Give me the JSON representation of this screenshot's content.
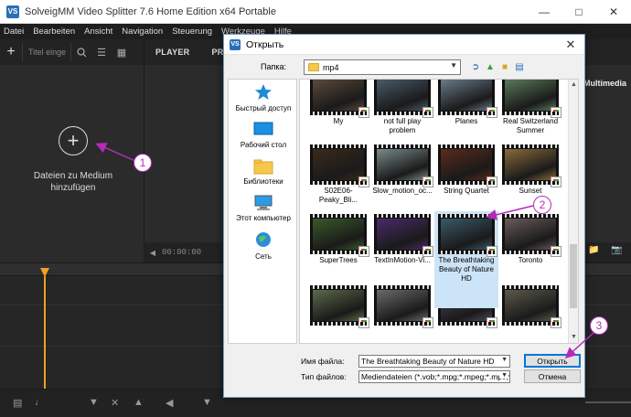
{
  "app": {
    "title": "SolveigMM Video Splitter 7.6 Home Edition x64 Portable",
    "logo": "VS",
    "menu": [
      "Datei",
      "Bearbeiten",
      "Ansicht",
      "Navigation",
      "Steuerung",
      "Werkzeuge",
      "Hilfe"
    ],
    "search_placeholder": "Titel einge",
    "add_media_label": "Dateien zu Medium hinzufügen",
    "tabs": [
      "PLAYER",
      "PRO"
    ],
    "multimedia_label": "Multimedia",
    "timecode": "00:00:00"
  },
  "dialog": {
    "title": "Открыть",
    "folder_label": "Папка:",
    "folder_name": "mp4",
    "places": [
      {
        "label": "Быстрый доступ",
        "icon": "star-icon"
      },
      {
        "label": "Рабочий стол",
        "icon": "desktop-icon"
      },
      {
        "label": "Библиотеки",
        "icon": "libraries-icon"
      },
      {
        "label": "Этот компьютер",
        "icon": "computer-icon"
      },
      {
        "label": "Сеть",
        "icon": "network-icon"
      }
    ],
    "files": [
      {
        "label": "My",
        "tone": "#5a4a3a"
      },
      {
        "label": "not full play problem",
        "tone": "#4a5a6a"
      },
      {
        "label": "Planes",
        "tone": "#6a7a8a"
      },
      {
        "label": "Real Switzerland Summer",
        "tone": "#5a7a5a"
      },
      {
        "label": "S02E06-Peaky_Bli...",
        "tone": "#3a2a1a"
      },
      {
        "label": "Slow_motion_oc...",
        "tone": "#7a8a8a"
      },
      {
        "label": "String Quartet",
        "tone": "#5a2a1a"
      },
      {
        "label": "Sunset",
        "tone": "#8a6a3a"
      },
      {
        "label": "SuperTrees",
        "tone": "#3a5a2a"
      },
      {
        "label": "TextInMotion-Vi...",
        "tone": "#4a2a6a"
      },
      {
        "label": "The Breathtaking Beauty of Nature HD",
        "tone": "#3a5a6a"
      },
      {
        "label": "Toronto",
        "tone": "#6a5a5a"
      },
      {
        "label": "",
        "tone": "#5a6a4a"
      },
      {
        "label": "",
        "tone": "#6a6a6a"
      },
      {
        "label": "",
        "tone": "#4a4a5a"
      },
      {
        "label": "",
        "tone": "#5a5a4a"
      }
    ],
    "filename_label": "Имя файла:",
    "filename_value": "The Breathtaking Beauty of Nature HD",
    "filetype_label": "Тип файлов:",
    "filetype_value": "Mediendateien (*.vob;*.mpg;*.mpeg;*.mpv;*.m2v",
    "open_button": "Открыть",
    "cancel_button": "Отмена"
  },
  "annotations": [
    "1",
    "2",
    "3"
  ],
  "colors": {
    "annotation": "#b22cb8",
    "playhead": "#f0a020",
    "selection": "#cce4f7"
  }
}
